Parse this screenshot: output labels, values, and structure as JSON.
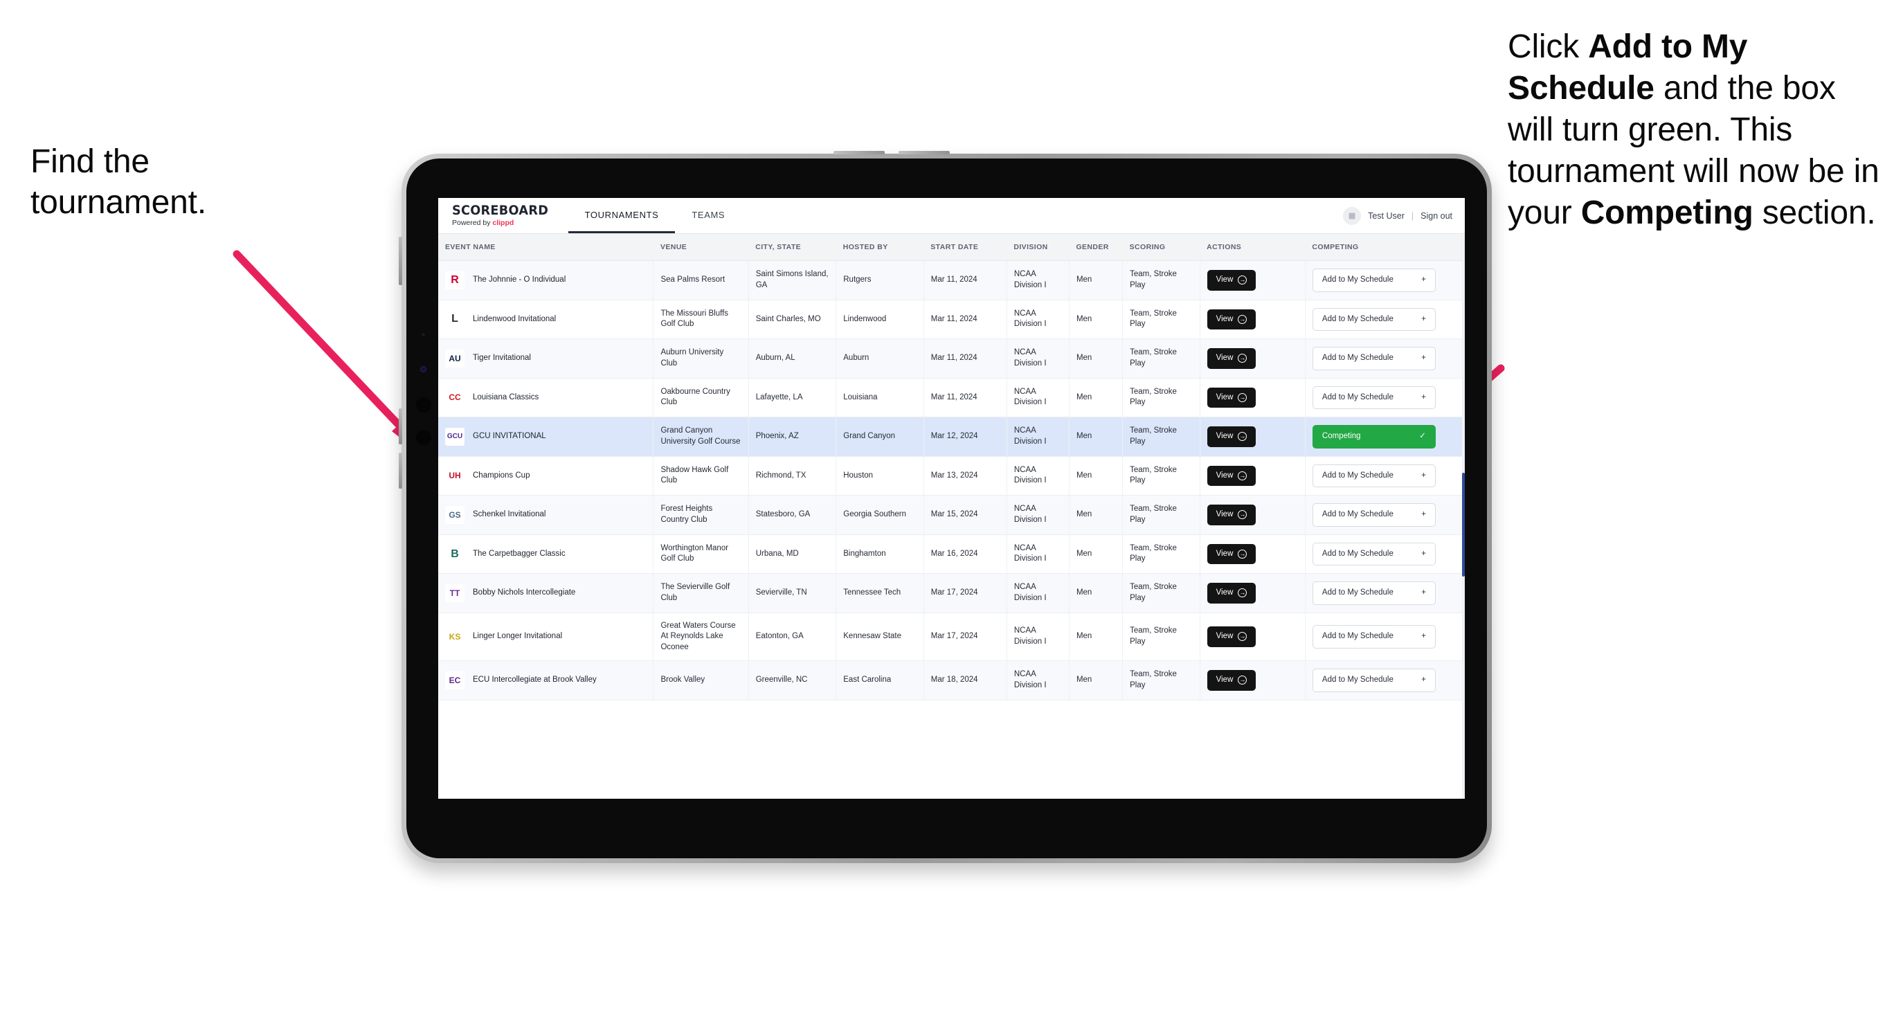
{
  "annotations": {
    "left": {
      "line1": "Find the",
      "line2": "tournament."
    },
    "right": {
      "p1_a": "Click ",
      "p1_b": "Add to My Schedule",
      "p1_c": " and the box will turn green. ",
      "p2_a": "This tournament will now be in your ",
      "p2_b": "Competing",
      "p2_c": " section."
    }
  },
  "app": {
    "brand": {
      "title": "SCOREBOARD",
      "powered_prefix": "Powered by ",
      "powered_brand": "clippd"
    },
    "nav": [
      {
        "label": "TOURNAMENTS",
        "active": true
      },
      {
        "label": "TEAMS",
        "active": false
      }
    ],
    "user": {
      "avatar_icon": "user-avatar-icon",
      "name": "Test User",
      "separator": "|",
      "signout": "Sign out"
    },
    "table": {
      "columns": [
        "EVENT NAME",
        "VENUE",
        "CITY, STATE",
        "HOSTED BY",
        "START DATE",
        "DIVISION",
        "GENDER",
        "SCORING",
        "ACTIONS",
        "COMPETING"
      ],
      "action_label": "View",
      "add_label": "Add to My Schedule",
      "add_icon": "plus-icon",
      "competing_label": "Competing",
      "competing_icon": "check-icon",
      "rows": [
        {
          "logo_text": "R",
          "logo_fg": "#CC0033",
          "logo_bg": "#ffffff",
          "name": "The Johnnie - O Individual",
          "venue": "Sea Palms Resort",
          "city": "Saint Simons Island, GA",
          "host": "Rutgers",
          "date": "Mar 11, 2024",
          "division": "NCAA Division I",
          "gender": "Men",
          "scoring": "Team, Stroke Play",
          "competing": false
        },
        {
          "logo_text": "L",
          "logo_fg": "#2b2b2b",
          "logo_bg": "#ffffff",
          "name": "Lindenwood Invitational",
          "venue": "The Missouri Bluffs Golf Club",
          "city": "Saint Charles, MO",
          "host": "Lindenwood",
          "date": "Mar 11, 2024",
          "division": "NCAA Division I",
          "gender": "Men",
          "scoring": "Team, Stroke Play",
          "competing": false
        },
        {
          "logo_text": "AU",
          "logo_fg": "#0C2340",
          "logo_bg": "#ffffff",
          "name": "Tiger Invitational",
          "venue": "Auburn University Club",
          "city": "Auburn, AL",
          "host": "Auburn",
          "date": "Mar 11, 2024",
          "division": "NCAA Division I",
          "gender": "Men",
          "scoring": "Team, Stroke Play",
          "competing": false
        },
        {
          "logo_text": "CC",
          "logo_fg": "#CE181E",
          "logo_bg": "#ffffff",
          "name": "Louisiana Classics",
          "venue": "Oakbourne Country Club",
          "city": "Lafayette, LA",
          "host": "Louisiana",
          "date": "Mar 11, 2024",
          "division": "NCAA Division I",
          "gender": "Men",
          "scoring": "Team, Stroke Play",
          "competing": false
        },
        {
          "logo_text": "GCU",
          "logo_fg": "#522398",
          "logo_bg": "#ffffff",
          "name": "GCU INVITATIONAL",
          "venue": "Grand Canyon University Golf Course",
          "city": "Phoenix, AZ",
          "host": "Grand Canyon",
          "date": "Mar 12, 2024",
          "division": "NCAA Division I",
          "gender": "Men",
          "scoring": "Team, Stroke Play",
          "competing": true
        },
        {
          "logo_text": "UH",
          "logo_fg": "#C8102E",
          "logo_bg": "#ffffff",
          "name": "Champions Cup",
          "venue": "Shadow Hawk Golf Club",
          "city": "Richmond, TX",
          "host": "Houston",
          "date": "Mar 13, 2024",
          "division": "NCAA Division I",
          "gender": "Men",
          "scoring": "Team, Stroke Play",
          "competing": false
        },
        {
          "logo_text": "GS",
          "logo_fg": "#4a6a86",
          "logo_bg": "#ffffff",
          "name": "Schenkel Invitational",
          "venue": "Forest Heights Country Club",
          "city": "Statesboro, GA",
          "host": "Georgia Southern",
          "date": "Mar 15, 2024",
          "division": "NCAA Division I",
          "gender": "Men",
          "scoring": "Team, Stroke Play",
          "competing": false
        },
        {
          "logo_text": "B",
          "logo_fg": "#1d6b5f",
          "logo_bg": "#ffffff",
          "name": "The Carpetbagger Classic",
          "venue": "Worthington Manor Golf Club",
          "city": "Urbana, MD",
          "host": "Binghamton",
          "date": "Mar 16, 2024",
          "division": "NCAA Division I",
          "gender": "Men",
          "scoring": "Team, Stroke Play",
          "competing": false
        },
        {
          "logo_text": "TT",
          "logo_fg": "#6A2C8F",
          "logo_bg": "#ffffff",
          "name": "Bobby Nichols Intercollegiate",
          "venue": "The Sevierville Golf Club",
          "city": "Sevierville, TN",
          "host": "Tennessee Tech",
          "date": "Mar 17, 2024",
          "division": "NCAA Division I",
          "gender": "Men",
          "scoring": "Team, Stroke Play",
          "competing": false
        },
        {
          "logo_text": "KS",
          "logo_fg": "#C8A415",
          "logo_bg": "#ffffff",
          "name": "Linger Longer Invitational",
          "venue": "Great Waters Course At Reynolds Lake Oconee",
          "city": "Eatonton, GA",
          "host": "Kennesaw State",
          "date": "Mar 17, 2024",
          "division": "NCAA Division I",
          "gender": "Men",
          "scoring": "Team, Stroke Play",
          "competing": false
        },
        {
          "logo_text": "EC",
          "logo_fg": "#592A8A",
          "logo_bg": "#ffffff",
          "name": "ECU Intercollegiate at Brook Valley",
          "venue": "Brook Valley",
          "city": "Greenville, NC",
          "host": "East Carolina",
          "date": "Mar 18, 2024",
          "division": "NCAA Division I",
          "gender": "Men",
          "scoring": "Team, Stroke Play",
          "competing": false
        }
      ]
    }
  },
  "colors": {
    "accent_pink": "#E8215C",
    "green": "#22A844",
    "selected_row": "#dbe6fa",
    "brand_red": "#f0335a"
  }
}
